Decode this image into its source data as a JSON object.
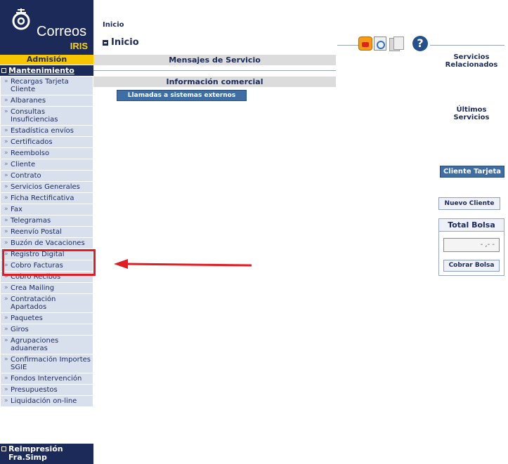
{
  "logo": {
    "brand": "Correos",
    "sub": "IRIS"
  },
  "sidebar": {
    "section_admision": "Admisión",
    "section_mantenimiento": "Mantenimiento",
    "items": [
      {
        "label": "Recargas Tarjeta Cliente"
      },
      {
        "label": "Albaranes"
      },
      {
        "label": "Consultas Insuficiencias"
      },
      {
        "label": "Estadística envíos"
      },
      {
        "label": "Certificados"
      },
      {
        "label": "Reembolso"
      },
      {
        "label": "Cliente"
      },
      {
        "label": "Contrato"
      },
      {
        "label": "Servicios Generales"
      },
      {
        "label": "Ficha Rectificativa"
      },
      {
        "label": "Fax"
      },
      {
        "label": "Telegramas"
      },
      {
        "label": "Reenvío Postal"
      },
      {
        "label": "Buzón de Vacaciones"
      },
      {
        "label": "Registro Digital"
      },
      {
        "label": "Cobro Facturas"
      },
      {
        "label": "Cobro Recibos"
      },
      {
        "label": "Crea Mailing"
      },
      {
        "label": "Contratación Apartados"
      },
      {
        "label": "Paquetes"
      },
      {
        "label": "Giros"
      },
      {
        "label": "Agrupaciones aduaneras"
      },
      {
        "label": "Confirmación Importes SGIE"
      },
      {
        "label": "Fondos Intervención"
      },
      {
        "label": "Presupuestos"
      },
      {
        "label": "Liquidación on-line"
      }
    ],
    "section_reimpresion": "Reimpresión Fra.Simp"
  },
  "breadcrumb": "Inicio",
  "page_title": "Inicio",
  "main": {
    "mensajes_label": "Mensajes de Servicio",
    "info_comercial_label": "Información comercial",
    "llamadas_button": "Llamadas a sistemas externos"
  },
  "right": {
    "servicios_relacionados": "Servicios Relacionados",
    "ultimos_servicios": "Últimos Servicios",
    "cliente_tarjeta_button": "Cliente Tarjeta",
    "nuevo_cliente_button": "Nuevo Cliente",
    "total_bolsa_title": "Total Bolsa",
    "total_bolsa_value": "- ,- -",
    "cobrar_bolsa_button": "Cobrar Bolsa"
  },
  "toolbar_icons": [
    "scale-icon",
    "search-doc-icon",
    "documents-icon",
    "help-icon"
  ],
  "colors": {
    "navy": "#1c2a5a",
    "yellow": "#f6c700",
    "menu_bg": "#d8e0ee",
    "highlight_red": "#e31b23",
    "button_blue": "#3f6ea5"
  }
}
